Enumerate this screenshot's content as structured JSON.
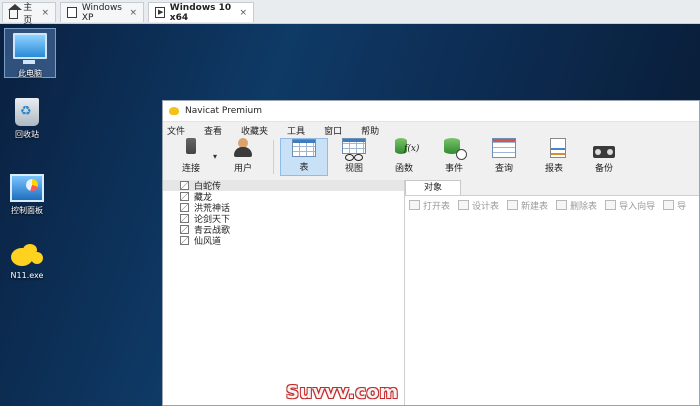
{
  "vm_tabs": [
    {
      "label": "主页",
      "icon": "home-icon"
    },
    {
      "label": "Windows XP",
      "icon": "vm-icon"
    },
    {
      "label": "Windows 10 x64",
      "icon": "vm-running-icon"
    }
  ],
  "vm_tab_close": "×",
  "desktop_icons": [
    {
      "label": "此电脑",
      "icon": "this-pc-icon"
    },
    {
      "label": "回收站",
      "icon": "recycle-bin-icon"
    },
    {
      "label": "控制面板",
      "icon": "control-panel-icon"
    },
    {
      "label": "N11.exe",
      "icon": "n11-app-icon"
    }
  ],
  "window": {
    "title": "Navicat Premium",
    "menu": [
      "文件",
      "查看",
      "收藏夹",
      "工具",
      "窗口",
      "帮助"
    ],
    "toolbar": {
      "connect": "连接",
      "connect_arrow": "▾",
      "user": "用户",
      "table": "表",
      "view": "视图",
      "function": "函数",
      "event": "事件",
      "query": "查询",
      "report": "报表",
      "backup": "备份"
    },
    "connections": [
      "白蛇传",
      "藏龙",
      "洪荒神话",
      "论剑天下",
      "青云战歌",
      "仙风道"
    ],
    "object_tab": "对象",
    "object_toolbar": [
      "打开表",
      "设计表",
      "新建表",
      "删除表",
      "导入向导",
      "导"
    ]
  },
  "watermark": "Suvvv.com"
}
